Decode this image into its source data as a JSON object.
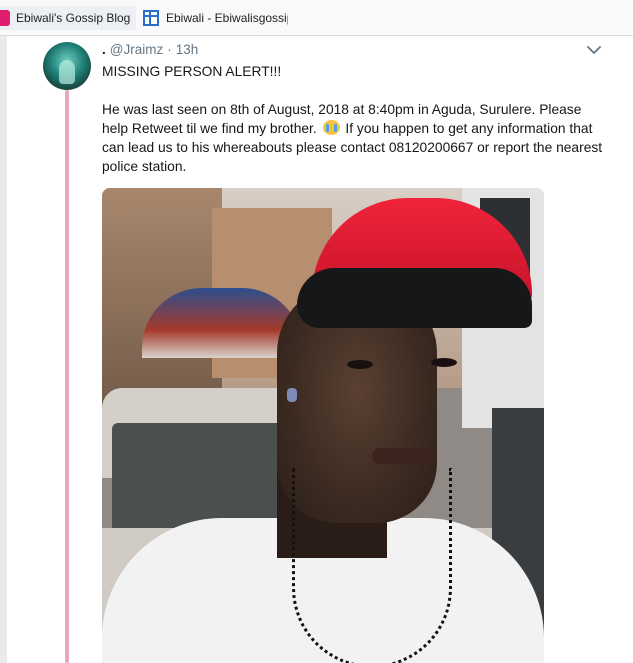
{
  "bookmarks": [
    {
      "label": "Ebiwali's Gossip Blog",
      "icon": "blog-favicon-icon"
    },
    {
      "label": "Ebiwali - Ebiwalisgossip",
      "icon": "page-icon"
    }
  ],
  "tweet": {
    "display_name": ".",
    "handle": "@Jraimz",
    "separator": "·",
    "time": "13h",
    "line1": "MISSING PERSON ALERT!!!",
    "para2_before_emoji": "He was last seen on 8th of August, 2018 at 8:40pm in Aguda, Surulere. Please help Retweet til we find my brother.",
    "emoji_name": "loudly-crying-face-icon",
    "para2_after_emoji": "If you happen to get any information that can lead us to his whereabouts please contact 08120200667 or report the nearest police station.",
    "photo_alt": "photo"
  },
  "colors": {
    "thread_line": "#e8a7bd",
    "accent": "#e01d6e",
    "text": "#14171a",
    "muted": "#657786"
  }
}
